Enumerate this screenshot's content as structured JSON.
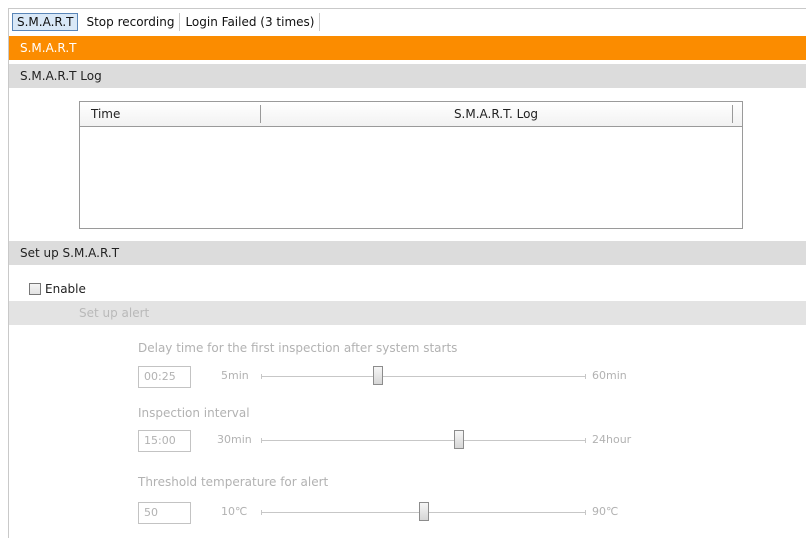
{
  "tabs": [
    {
      "label": "S.M.A.R.T",
      "active": true
    },
    {
      "label": "Stop recording",
      "active": false
    },
    {
      "label": "Login Failed (3 times)",
      "active": false
    }
  ],
  "title_bar": "S.M.A.R.T",
  "log_section": {
    "heading": "S.M.A.R.T Log",
    "columns": [
      "Time",
      "S.M.A.R.T. Log"
    ],
    "rows": []
  },
  "setup_section": {
    "heading": "Set up S.M.A.R.T",
    "enable_label": "Enable",
    "enable_checked": false
  },
  "alert_section": {
    "heading": "Set up alert",
    "settings": [
      {
        "label": "Delay time for the first inspection after system starts",
        "value": "00:25",
        "min": "5min",
        "max": "60min",
        "level": 0.36
      },
      {
        "label": "Inspection interval",
        "value": "15:00",
        "min": "30min",
        "max": "24hour",
        "level": 0.61
      },
      {
        "label": "Threshold temperature for alert",
        "value": "50",
        "min": "10℃",
        "max": "90℃",
        "level": 0.5
      }
    ]
  },
  "colors": {
    "accent": "#fb8c00",
    "section_bg": "#dcdcdc",
    "active_tab": "#d9e8f7"
  }
}
